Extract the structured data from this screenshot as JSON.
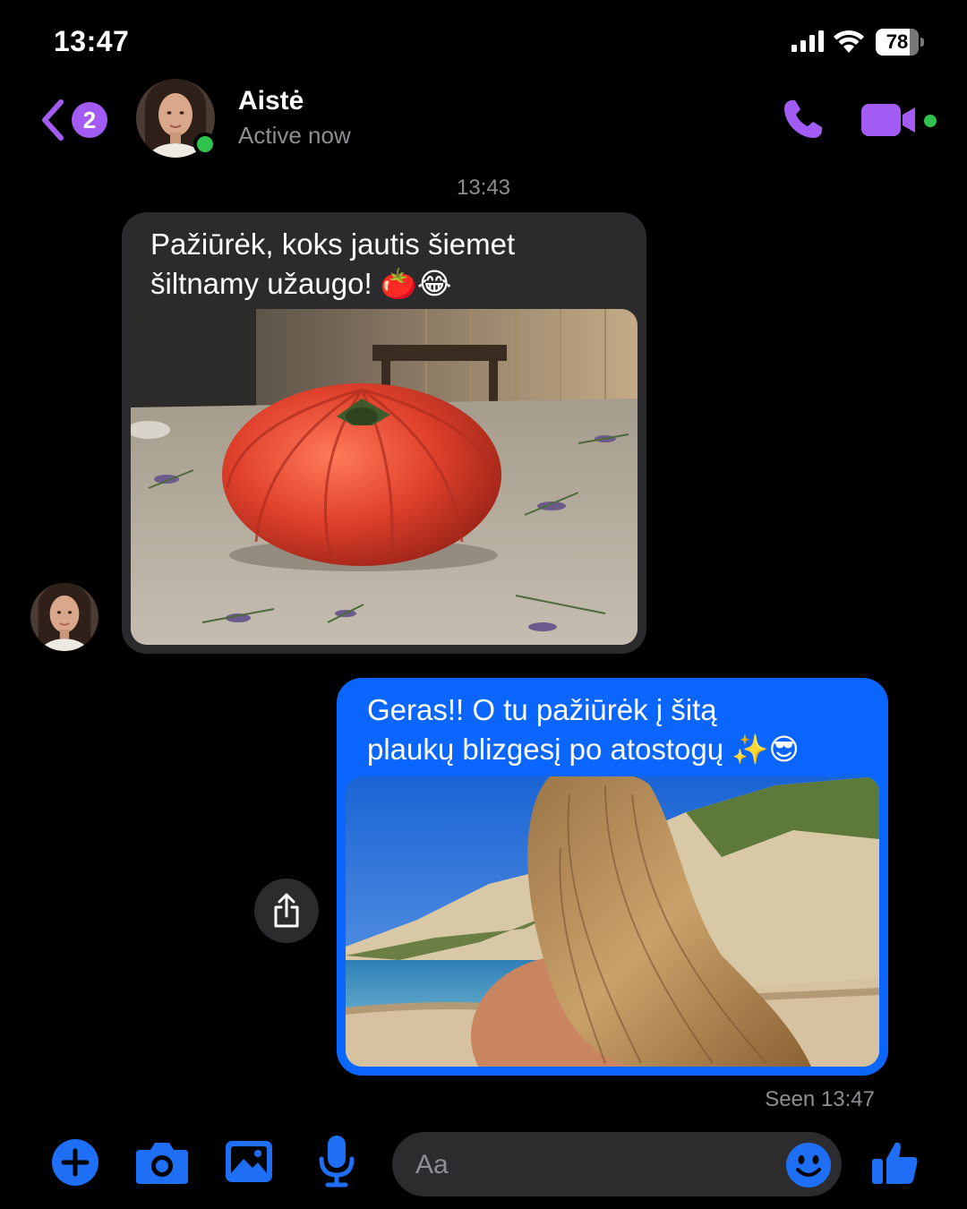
{
  "status_bar": {
    "time": "13:47",
    "battery": "78"
  },
  "header": {
    "back_badge": "2",
    "contact_name": "Aistė",
    "contact_status": "Active now"
  },
  "conversation": {
    "timestamp": "13:43",
    "incoming": {
      "line1": "Pažiūrėk, koks jautis šiemet",
      "line2": "šiltnamy užaugo! 🍅😂",
      "photo": "tomato-photo"
    },
    "outgoing": {
      "line1": "Geras!! O tu pažiūrėk į šitą",
      "line2": "plaukų blizgesį po atostogų ✨😎",
      "photo": "beach-hair-photo"
    },
    "seen": "Seen 13:47"
  },
  "composer": {
    "placeholder": "Aa"
  },
  "colors": {
    "accent_purple": "#a35cf3",
    "outgoing_bubble": "#0a66ff",
    "incoming_bubble": "#2b2b2d",
    "composer_blue": "#1e6ff5",
    "online_green": "#31c24d"
  },
  "icons": [
    "back-chevron-icon",
    "phone-icon",
    "video-camera-icon",
    "share-icon",
    "plus-icon",
    "camera-icon",
    "gallery-icon",
    "microphone-icon",
    "emoji-icon",
    "thumbs-up-icon"
  ]
}
